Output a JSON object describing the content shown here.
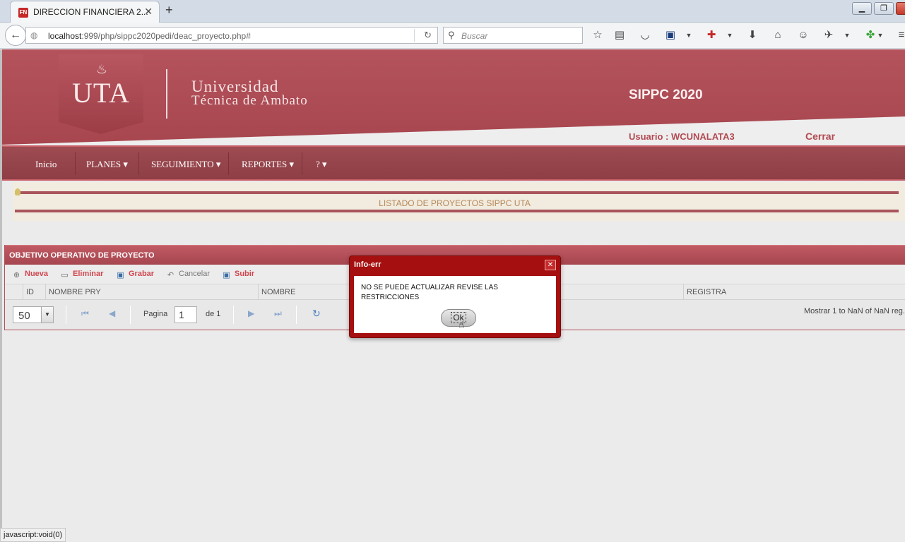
{
  "browser": {
    "tab_title": "DIRECCION FINANCIERA 2...",
    "favicon_text": "FN",
    "url_host": "localhost",
    "url_rest": ":999/php/sippc2020pedi/deac_proyecto.php#",
    "search_placeholder": "Buscar",
    "status_text": "javascript:void(0)"
  },
  "header": {
    "logo_text": "UTA",
    "university_line1": "Universidad",
    "university_line2": "Técnica de Ambato",
    "system_title": "SIPPC 2020",
    "user_label": "Usuario : WCUNALATA3",
    "logout_label": "Cerrar"
  },
  "menu": {
    "items": [
      {
        "label": "Inicio"
      },
      {
        "label": "PLANES ▾"
      },
      {
        "label": "SEGUIMIENTO ▾"
      },
      {
        "label": "REPORTES ▾"
      },
      {
        "label": "? ▾"
      }
    ]
  },
  "info": {
    "text": "LISTADO DE PROYECTOS SIPPC UTA"
  },
  "panel": {
    "title": "OBJETIVO OPERATIVO DE PROYECTO",
    "toolbar": {
      "new_label": "Nueva",
      "delete_label": "Eliminar",
      "save_label": "Grabar",
      "cancel_label": "Cancelar",
      "upload_label": "Subir"
    },
    "columns": [
      "ID",
      "NOMBRE PRY",
      "NOMBRE",
      "REGISTRA"
    ],
    "pager": {
      "page_size": "50",
      "page_label": "Pagina",
      "page_value": "1",
      "of_label": "de 1",
      "info": "Mostrar 1 to NaN of NaN reg."
    }
  },
  "dialog": {
    "title": "Info-err",
    "message": "NO SE PUEDE ACTUALIZAR REVISE LAS RESTRICCIONES",
    "ok_label": "Ok"
  },
  "colors": {
    "brand": "#a7464f",
    "menu": "#8e3e45",
    "dialog": "#a50f0f"
  }
}
